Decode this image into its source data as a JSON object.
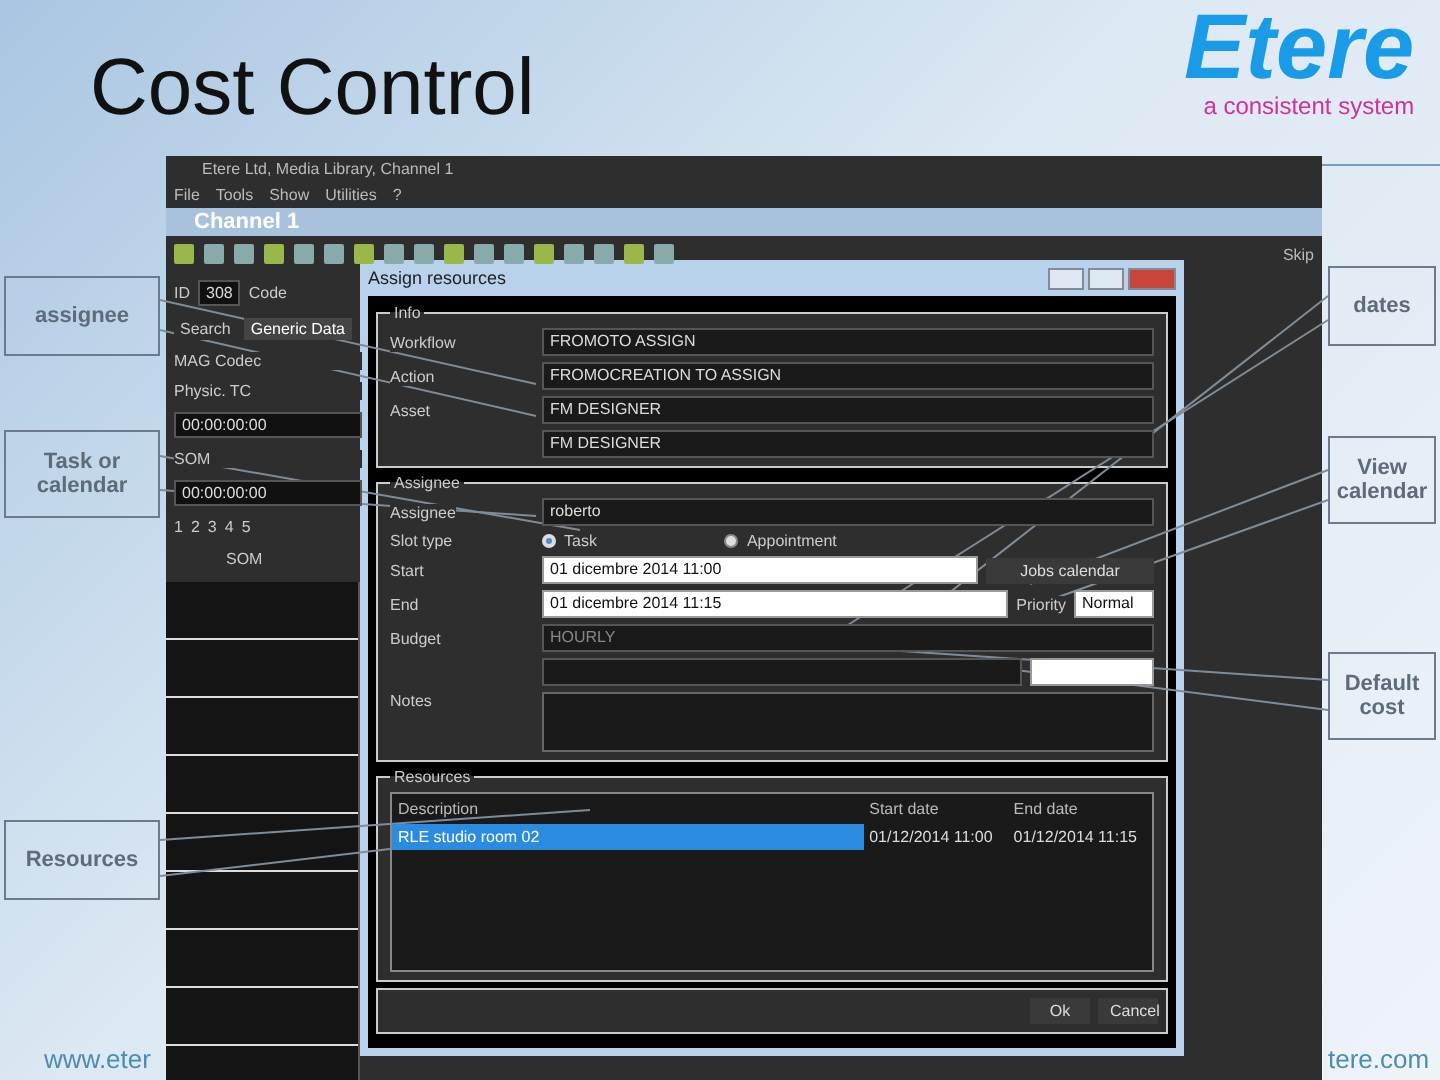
{
  "slide": {
    "title": "Cost Control",
    "logo_name": "Etere",
    "logo_tagline": "a consistent system",
    "footer_left": "www.eter",
    "footer_right": "tere.com"
  },
  "app": {
    "title": "Etere Ltd, Media Library, Channel 1",
    "menu": [
      "File",
      "Tools",
      "Show",
      "Utilities",
      "?"
    ],
    "channel": "Channel 1",
    "id_label": "ID",
    "id_value": "308",
    "code_label": "Code",
    "tabs": [
      {
        "label": "Search",
        "selected": false
      },
      {
        "label": "Generic Data",
        "selected": true
      }
    ],
    "codec": "MAG Codec",
    "fields": [
      {
        "label": "Physic. TC",
        "value": "00:00:00:00"
      },
      {
        "label": "SOM",
        "value": "00:00:00:00"
      }
    ],
    "pages": [
      "1",
      "2",
      "3",
      "4",
      "5"
    ],
    "grid_header": "SOM",
    "side_label": "Skip"
  },
  "dialog": {
    "title": "Assign resources",
    "info": {
      "legend": "Info",
      "rows": [
        {
          "label": "Workflow",
          "value": "FROMOTO ASSIGN"
        },
        {
          "label": "Action",
          "value": "FROMOCREATION TO ASSIGN"
        },
        {
          "label": "Asset",
          "value": "FM DESIGNER"
        },
        {
          "label": "",
          "value": "FM DESIGNER"
        }
      ]
    },
    "assignee": {
      "legend": "Assignee",
      "assignee_label": "Assignee",
      "assignee_value": "roberto",
      "slot_label": "Slot type",
      "slot_options": [
        {
          "label": "Task",
          "selected": true
        },
        {
          "label": "Appointment",
          "selected": false
        }
      ],
      "start_label": "Start",
      "start_value": "01 dicembre 2014 11:00",
      "jobs_button": "Jobs calendar",
      "end_label": "End",
      "end_value": "01 dicembre 2014 11:15",
      "priority_label": "Priority",
      "priority_value": "Normal",
      "budget_label": "Budget",
      "budget_value": "HOURLY",
      "notes_label": "Notes"
    },
    "resources": {
      "legend": "Resources",
      "columns": [
        "Description",
        "Start date",
        "End date"
      ],
      "rows": [
        {
          "cells": [
            "RLE studio room 02",
            "01/12/2014 11:00",
            "01/12/2014 11:15"
          ],
          "selected": true
        }
      ]
    },
    "buttons": [
      "Ok",
      "Cancel"
    ]
  },
  "callouts": [
    {
      "label": "assignee"
    },
    {
      "label": "dates"
    },
    {
      "label": "Task or calendar"
    },
    {
      "label": "View calendar"
    },
    {
      "label": "Default cost"
    },
    {
      "label": "Resources"
    }
  ]
}
